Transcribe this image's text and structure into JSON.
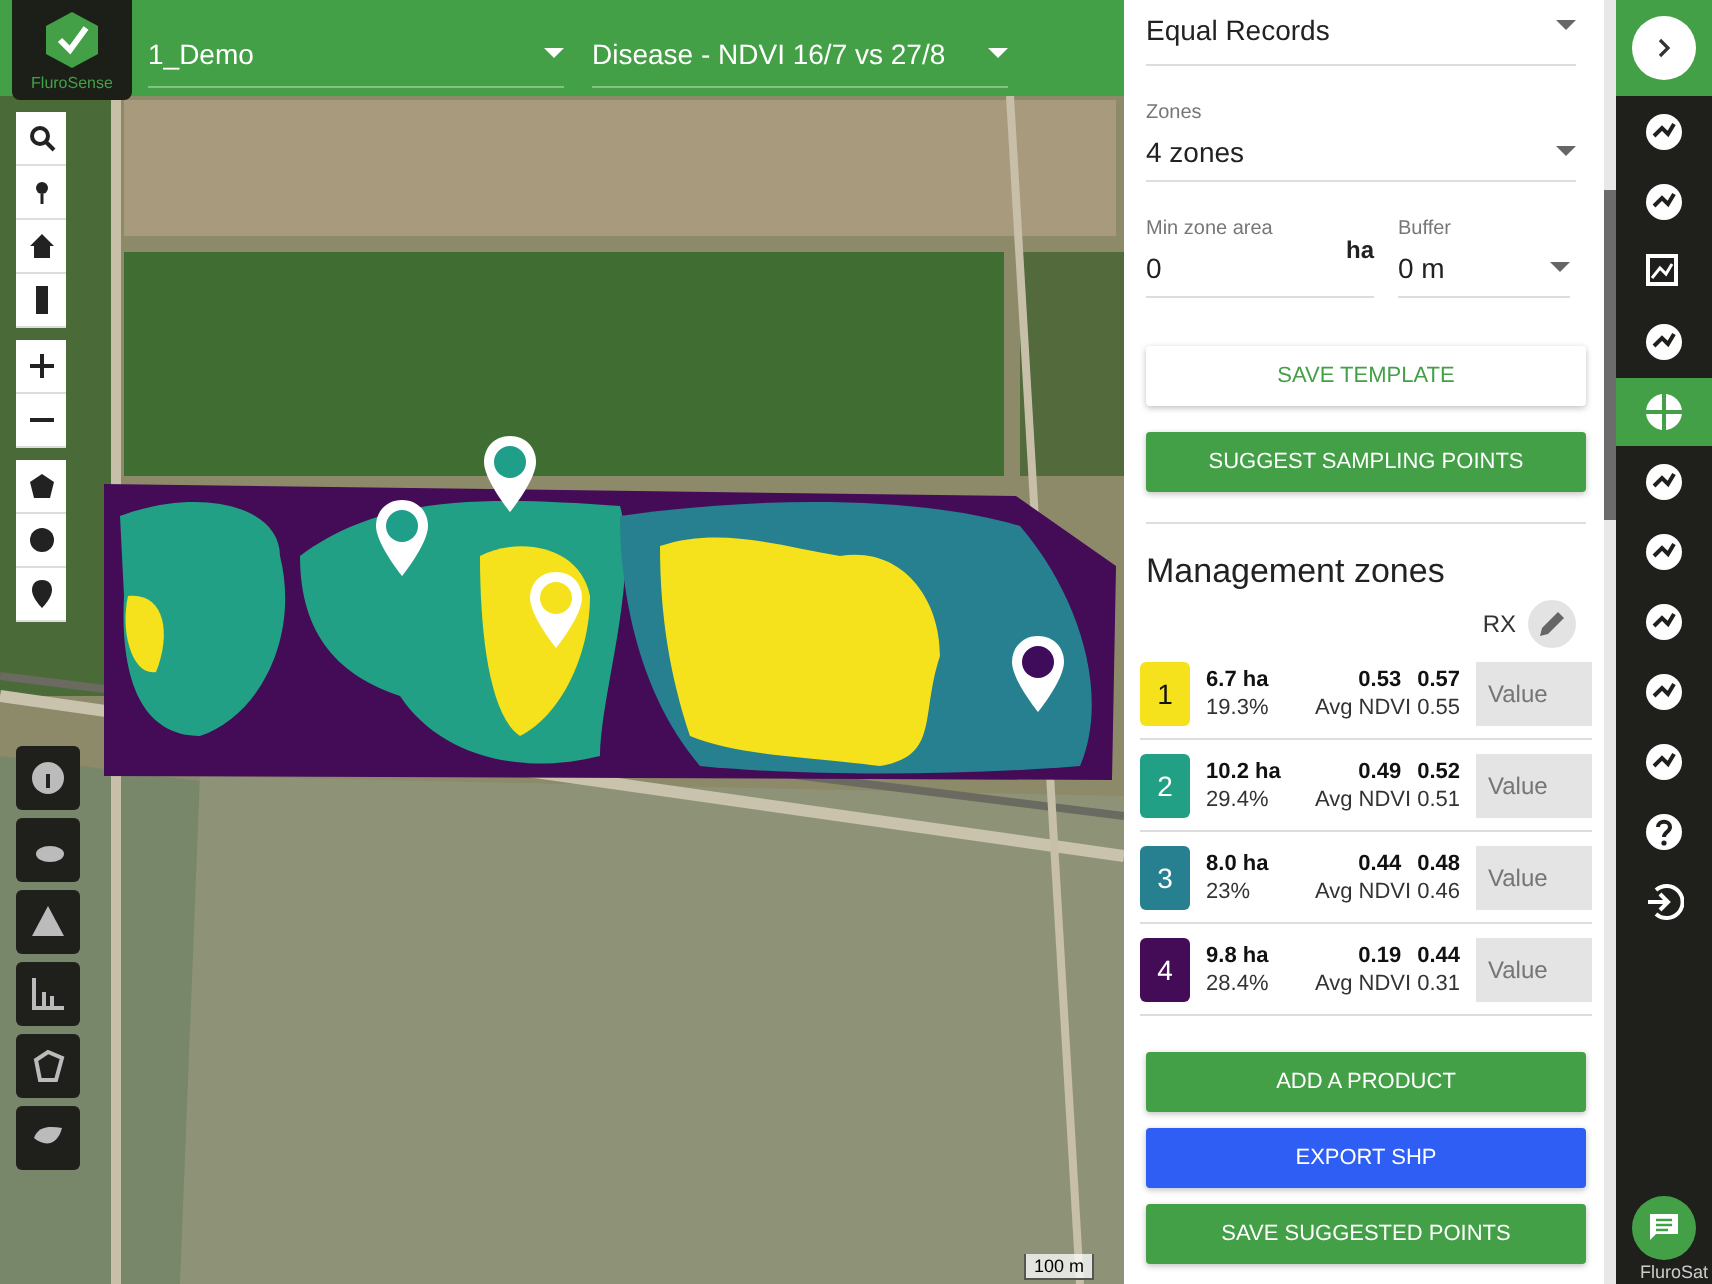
{
  "header": {
    "logo_text": "FluroSense",
    "farm_select": "1_Demo",
    "layer_select": "Disease - NDVI 16/7 vs 27/8"
  },
  "map": {
    "scale_label": "100 m",
    "attribution": "FluroSat",
    "pins": [
      {
        "color": "#1f9e8a"
      },
      {
        "color": "#1f9e8a"
      },
      {
        "color": "#f5e21d"
      },
      {
        "color": "#3f0b5b"
      }
    ]
  },
  "panel": {
    "method_select": "Equal Records",
    "zones_label": "Zones",
    "zones_value": "4 zones",
    "min_area_label": "Min zone area",
    "min_area_value": "0",
    "min_area_unit": "ha",
    "buffer_label": "Buffer",
    "buffer_value": "0 m",
    "save_template": "SAVE TEMPLATE",
    "suggest_points": "SUGGEST SAMPLING POINTS",
    "title": "Management zones",
    "rx_label": "RX",
    "zones": [
      {
        "number": "1",
        "color": "#f5e21d",
        "area": "6.7 ha",
        "percent": "19.3%",
        "min": "0.53",
        "max": "0.57",
        "avg": "Avg NDVI 0.55",
        "placeholder": "Value"
      },
      {
        "number": "2",
        "color": "#22a085",
        "area": "10.2 ha",
        "percent": "29.4%",
        "min": "0.49",
        "max": "0.52",
        "avg": "Avg NDVI 0.51",
        "placeholder": "Value"
      },
      {
        "number": "3",
        "color": "#26808f",
        "area": "8.0 ha",
        "percent": "23%",
        "min": "0.44",
        "max": "0.48",
        "avg": "Avg NDVI 0.46",
        "placeholder": "Value"
      },
      {
        "number": "4",
        "color": "#440b57",
        "area": "9.8 ha",
        "percent": "28.4%",
        "min": "0.19",
        "max": "0.44",
        "avg": "Avg NDVI 0.31",
        "placeholder": "Value"
      }
    ],
    "add_product": "ADD A PRODUCT",
    "export": "EXPORT SHP",
    "save_points": "SAVE SUGGESTED POINTS"
  },
  "sidebar_items": [
    {
      "selected": false
    },
    {
      "selected": false
    },
    {
      "selected": false
    },
    {
      "selected": false
    },
    {
      "selected": true
    },
    {
      "selected": false
    },
    {
      "selected": false
    },
    {
      "selected": false
    },
    {
      "selected": false
    },
    {
      "selected": false
    },
    {
      "selected": false
    },
    {
      "selected": false
    }
  ]
}
